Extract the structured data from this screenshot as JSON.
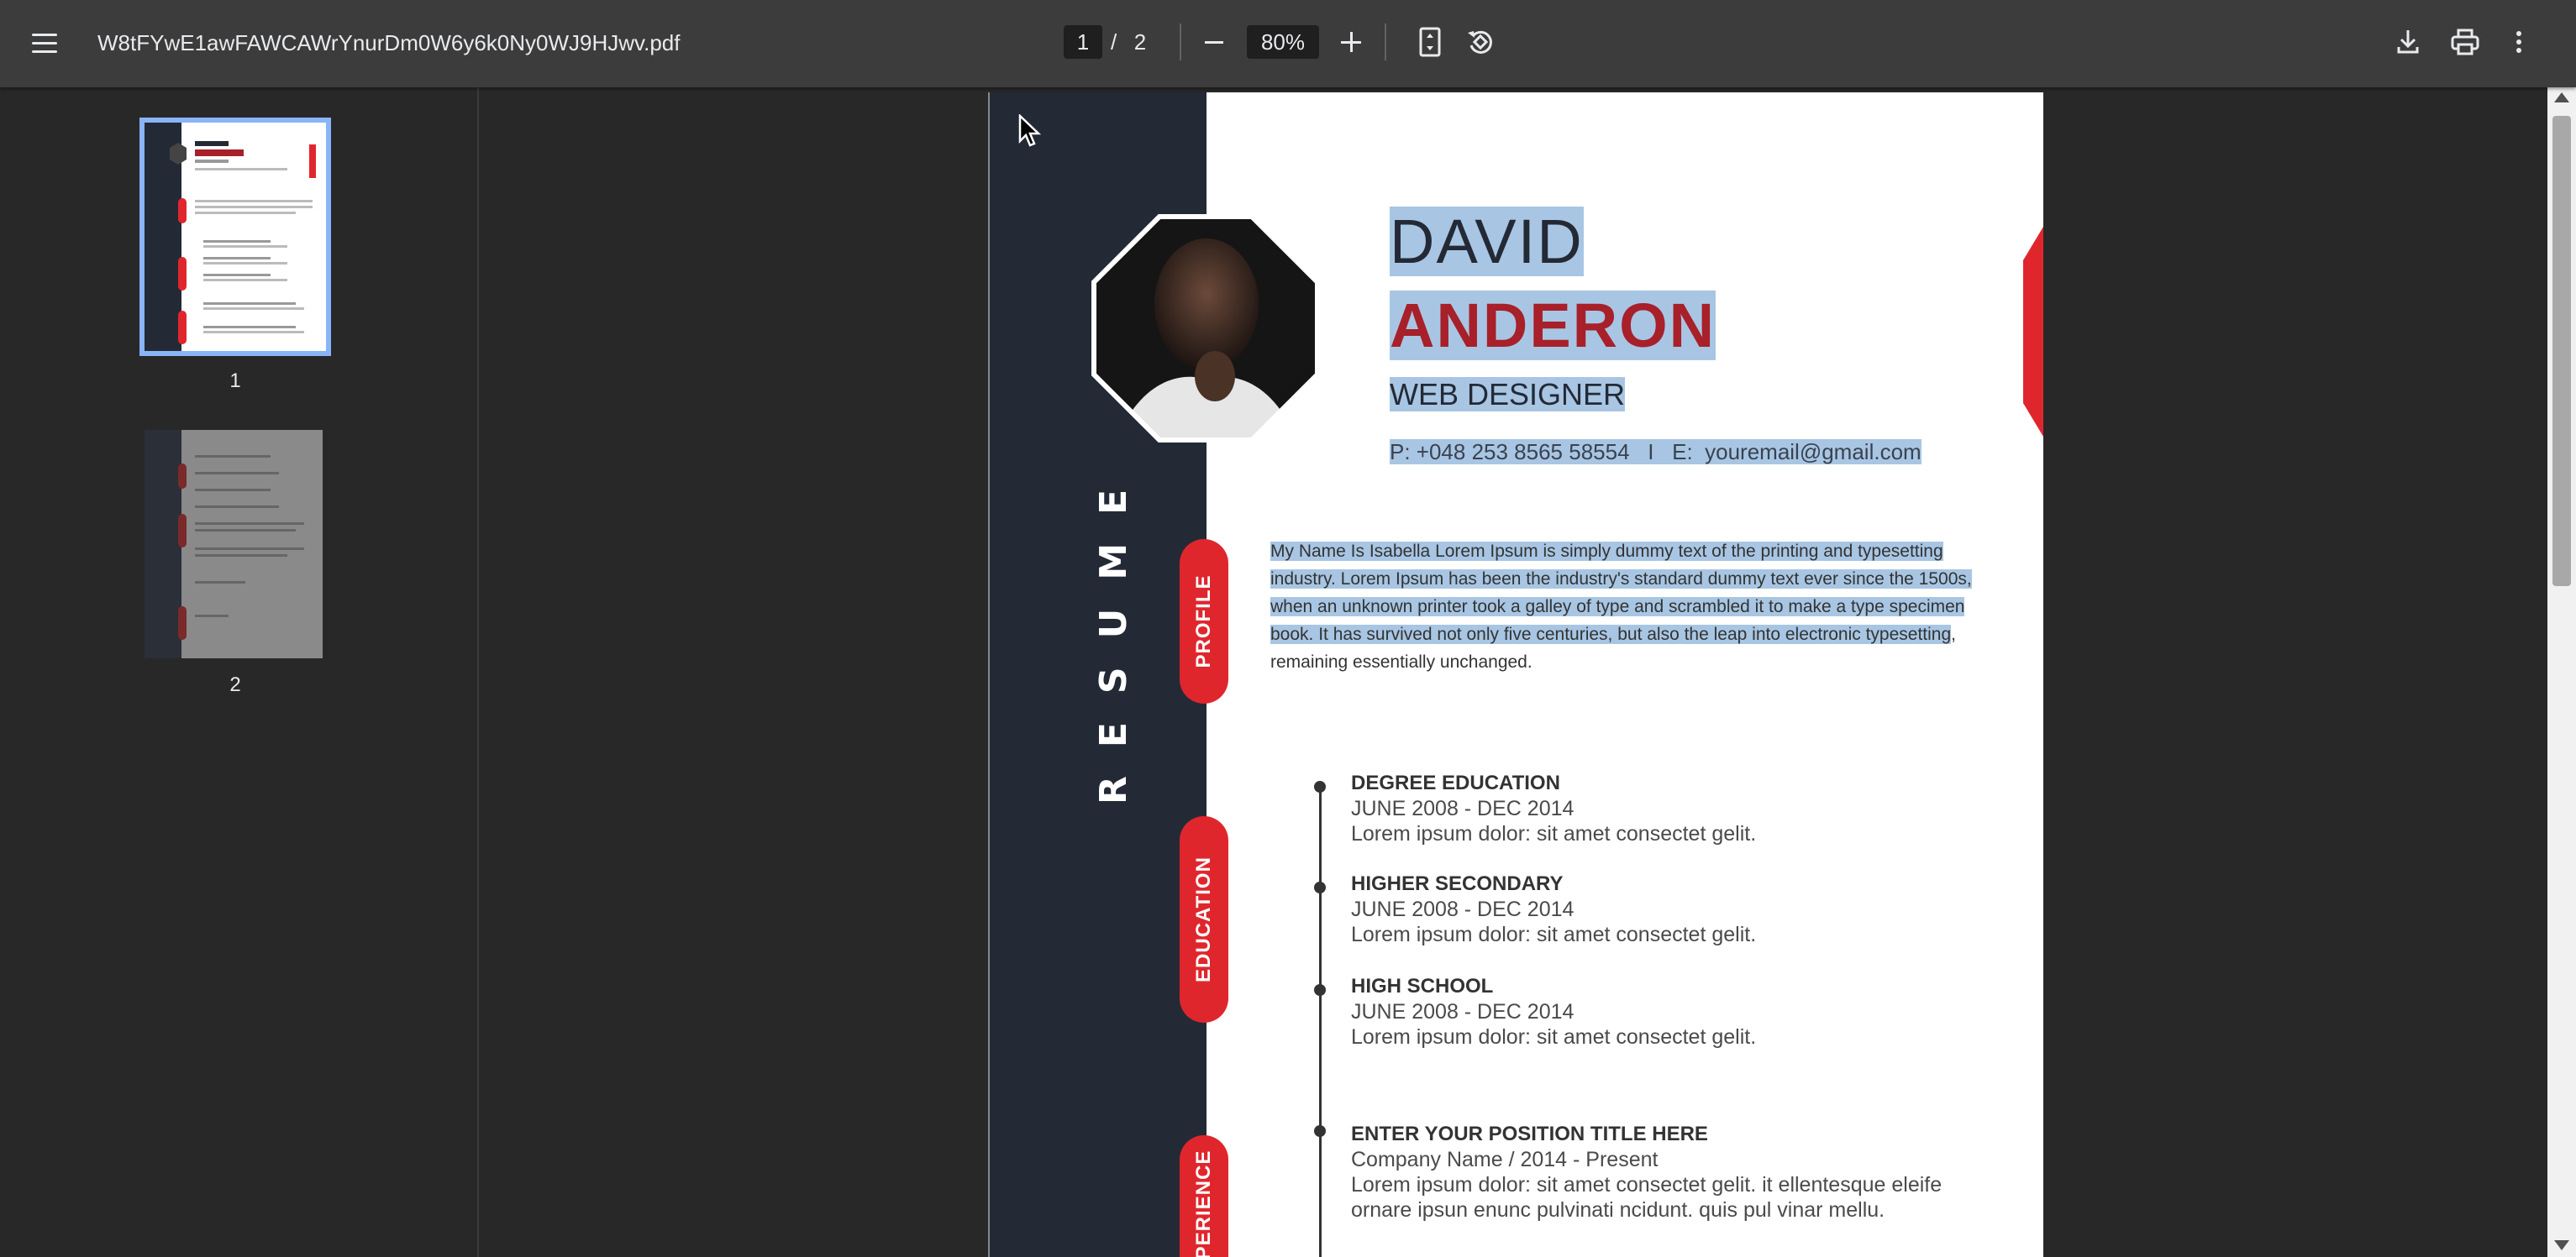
{
  "toolbar": {
    "filename": "W8tFYwE1awFAWCAWrYnurDm0W6y6k0Ny0WJ9HJwv.pdf",
    "page_current": "1",
    "page_separator": "/",
    "page_total": "2",
    "zoom": "80%"
  },
  "sidebar": {
    "thumbnails": [
      {
        "number": "1"
      },
      {
        "number": "2"
      }
    ]
  },
  "resume": {
    "first_name": "DAVID",
    "last_name": "ANDERON",
    "job_title": "WEB DESIGNER",
    "contact": "P: +048 253 8565 58554   I   E:  youremail@gmail.com",
    "vertical_label": "RESUME",
    "section_labels": {
      "profile": "PROFILE",
      "education": "EDUCATION",
      "experience": "EXPERIENCE"
    },
    "profile_selected": "My Name Is Isabella Lorem Ipsum is simply dummy text of the printing and typesetting industry. Lorem Ipsum has been the industry's standard dummy text ever since the 1500s, when an unknown printer took a galley of type and scrambled it to make a type specimen book. It has survived not only five centuries, but also the leap into electronic typesetting",
    "profile_rest": ", remaining essentially unchanged.",
    "education": [
      {
        "title": "DEGREE EDUCATION",
        "dates": "JUNE 2008 - DEC 2014",
        "text": "Lorem ipsum dolor: sit amet consectet gelit."
      },
      {
        "title": "HIGHER SECONDARY",
        "dates": "JUNE 2008 - DEC 2014",
        "text": "Lorem ipsum dolor: sit amet consectet gelit."
      },
      {
        "title": "HIGH SCHOOL",
        "dates": "JUNE 2008 - DEC 2014",
        "text": "Lorem ipsum dolor: sit amet consectet gelit."
      }
    ],
    "experience": [
      {
        "title": "ENTER YOUR POSITION TITLE HERE",
        "company": "Company Name / 2014 - Present",
        "text": "Lorem ipsum dolor: sit amet consectet gelit. it ellentesque eleife ornare ipsun enunc pulvinati ncidunt. quis pul vinar mellu."
      }
    ]
  },
  "colors": {
    "toolbar_bg": "#3c3c3c",
    "viewer_bg": "#282828",
    "resume_sidebar": "#232a36",
    "accent_red": "#e0262d",
    "name_red": "#a7202a",
    "selection": "#a8c6e3",
    "thumb_selected": "#8ab4f8"
  }
}
